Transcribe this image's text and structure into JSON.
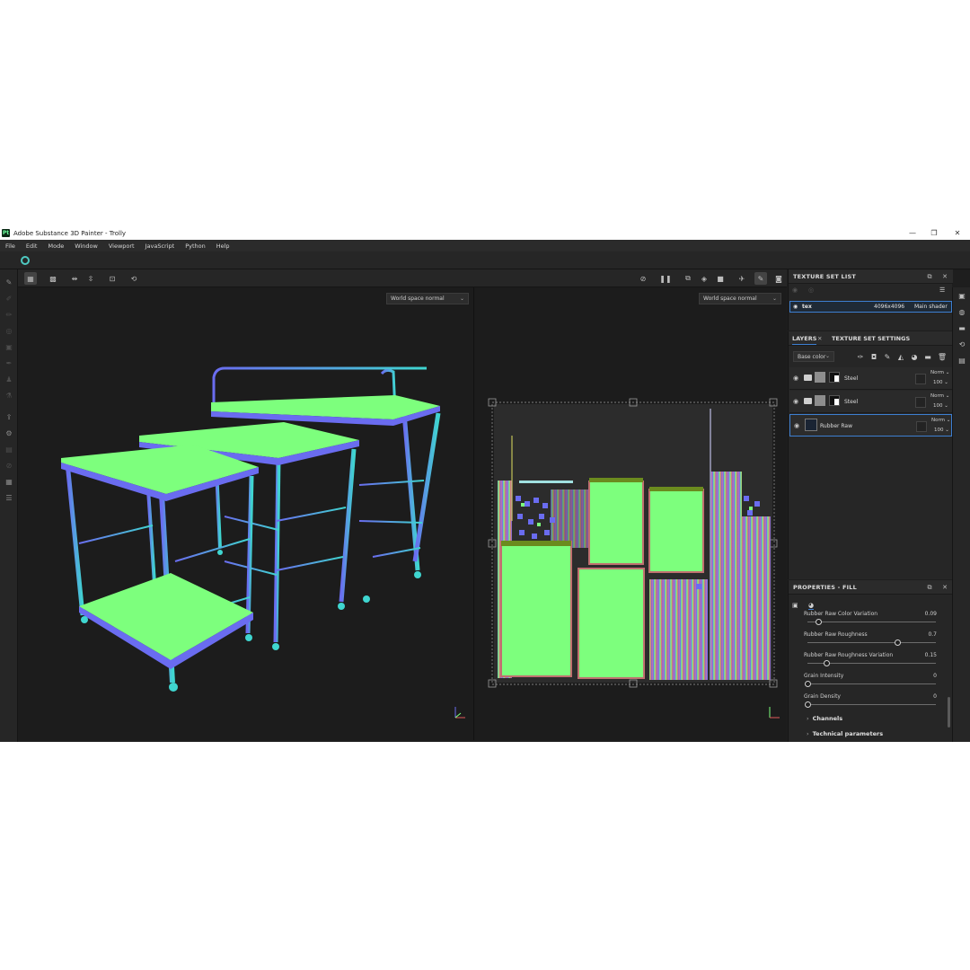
{
  "window": {
    "title": "Adobe Substance 3D Painter - Trolly",
    "app_icon_text": "Pt",
    "controls": [
      "—",
      "❐",
      "✕"
    ]
  },
  "menu": [
    "File",
    "Edit",
    "Mode",
    "Window",
    "Viewport",
    "JavaScript",
    "Python",
    "Help"
  ],
  "viewport_left": {
    "mode_select": "World space normal"
  },
  "viewport_right": {
    "mode_select": "World space normal"
  },
  "texture_set_list": {
    "title": "TEXTURE SET LIST",
    "row": {
      "name": "tex",
      "resolution": "4096x4096",
      "shader": "Main shader"
    }
  },
  "layers_panel": {
    "tabs": [
      "LAYERS",
      "TEXTURE SET SETTINGS"
    ],
    "channel": "Base color",
    "layers": [
      {
        "name": "Steel",
        "blend": "Norm",
        "opacity": "100"
      },
      {
        "name": "Steel",
        "blend": "Norm",
        "opacity": "100"
      },
      {
        "name": "Rubber Raw",
        "blend": "Norm",
        "opacity": "100"
      }
    ]
  },
  "properties": {
    "title": "PROPERTIES - FILL",
    "params": [
      {
        "label": "Rubber Raw Color Variation",
        "value": "0.09",
        "level": 0.09
      },
      {
        "label": "Rubber Raw Roughness",
        "value": "0.7",
        "level": 0.7
      },
      {
        "label": "Rubber Raw Roughness Variation",
        "value": "0.15",
        "level": 0.15
      },
      {
        "label": "Grain Intensity",
        "value": "0",
        "level": 0
      },
      {
        "label": "Grain Density",
        "value": "0",
        "level": 0
      }
    ],
    "sections": [
      "Channels",
      "Technical parameters"
    ]
  },
  "colors": {
    "bg": "#1e1e1e",
    "accent": "#3d7fd1",
    "normal_green": "#7dff7d",
    "normal_blue": "#6a6cf0",
    "normal_cyan": "#3fd6d0"
  },
  "icons": {
    "left_tools": [
      "paint-brush-icon",
      "eraser-icon",
      "projection-icon",
      "polygon-fill-icon",
      "smudge-icon",
      "clone-icon",
      "color-picker-icon",
      "geometry-icon",
      "export-icon",
      "bake-icon",
      "delete-icon",
      "iray-icon",
      "shelf-icon",
      "assets-icon"
    ],
    "right_strip": [
      "texture-set-icon",
      "display-settings-icon",
      "shader-icon",
      "history-icon",
      "settings-icon"
    ]
  }
}
